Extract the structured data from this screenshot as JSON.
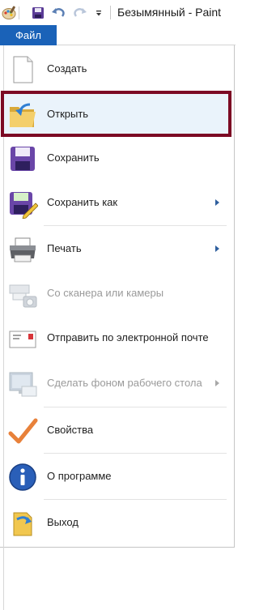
{
  "window": {
    "title": "Безымянный - Paint"
  },
  "quick_access": {
    "items": [
      {
        "name": "paint-app-icon"
      },
      {
        "name": "save-icon"
      },
      {
        "name": "undo-icon"
      },
      {
        "name": "redo-icon"
      },
      {
        "name": "customize-dropdown-icon"
      }
    ]
  },
  "tab": {
    "label": "Файл"
  },
  "menu": {
    "items": [
      {
        "key": "new",
        "label": "Создать",
        "icon": "blank-page-icon",
        "enabled": true,
        "submenu": false
      },
      {
        "key": "open",
        "label": "Открыть",
        "icon": "open-folder-icon",
        "enabled": true,
        "submenu": false,
        "highlighted": true
      },
      {
        "key": "save",
        "label": "Сохранить",
        "icon": "floppy-disk-icon",
        "enabled": true,
        "submenu": false
      },
      {
        "key": "save_as",
        "label": "Сохранить как",
        "icon": "save-as-icon",
        "enabled": true,
        "submenu": true
      },
      {
        "key": "print",
        "label": "Печать",
        "icon": "printer-icon",
        "enabled": true,
        "submenu": true
      },
      {
        "key": "scanner",
        "label": "Со сканера или камеры",
        "icon": "scanner-camera-icon",
        "enabled": false,
        "submenu": false
      },
      {
        "key": "email",
        "label": "Отправить по электронной почте",
        "icon": "envelope-icon",
        "enabled": true,
        "submenu": false
      },
      {
        "key": "wallpaper",
        "label": "Сделать фоном рабочего стола",
        "icon": "desktop-monitor-icon",
        "enabled": false,
        "submenu": true
      },
      {
        "key": "properties",
        "label": "Свойства",
        "icon": "checkmark-icon",
        "enabled": true,
        "submenu": false
      },
      {
        "key": "about",
        "label": "О программе",
        "icon": "info-icon",
        "enabled": true,
        "submenu": false
      },
      {
        "key": "exit",
        "label": "Выход",
        "icon": "exit-door-icon",
        "enabled": true,
        "submenu": false
      }
    ]
  },
  "colors": {
    "tab_blue": "#1a62b8",
    "highlight_border": "#7c0a24",
    "hover_bg": "#eaf3fb",
    "disabled_text": "#9a9a9a"
  }
}
